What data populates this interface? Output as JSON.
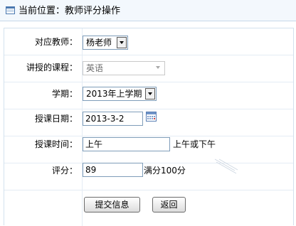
{
  "header": {
    "title": "当前位置：教师评分操作"
  },
  "form": {
    "teacher": {
      "label": "对应教师：",
      "value": "杨老师"
    },
    "course": {
      "label": "讲授的课程：",
      "value": "英语"
    },
    "semester": {
      "label": "学期：",
      "value": "2013年上学期"
    },
    "date": {
      "label": "授课日期：",
      "value": "2013-3-2"
    },
    "time": {
      "label": "授课时间：",
      "value": "上午",
      "hint": "上午或下午"
    },
    "score": {
      "label": "评分：",
      "value": "89",
      "hint": "满分100分"
    }
  },
  "actions": {
    "submit_label": "提交信息",
    "back_label": "返回"
  },
  "icons": [
    "window-icon",
    "calendar-icon",
    "dropdown-arrow-icon"
  ],
  "colors": {
    "header_bg": "#f3f8fd",
    "border": "#d3e1ee",
    "input_border": "#7f9db9"
  }
}
